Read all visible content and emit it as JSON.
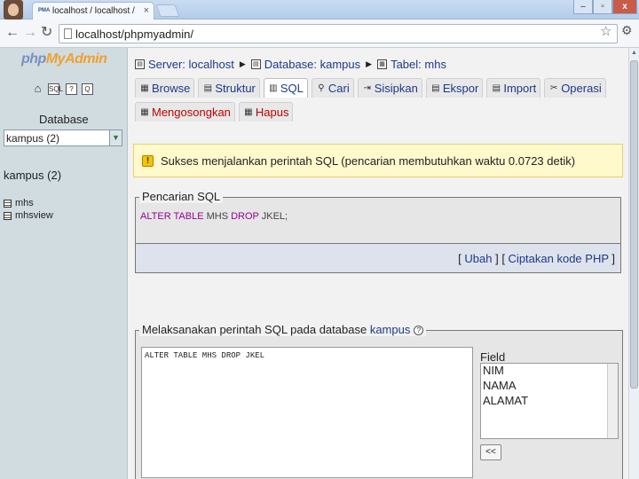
{
  "browser": {
    "tab_title": "localhost / localhost / kampus",
    "tab_favicon": "PMA",
    "url": "localhost/phpmyadmin/",
    "win_min": "–",
    "win_max": "▫",
    "win_close": "x"
  },
  "nav": {
    "logo_php": "php",
    "logo_my": "My",
    "logo_admin": "Admin",
    "database_label": "Database",
    "db_select_value": "kampus (2)",
    "db_name": "kampus (2)",
    "tables": [
      "mhs",
      "mhsview"
    ]
  },
  "breadcrumb": {
    "server": "Server: localhost",
    "database": "Database: kampus",
    "table": "Tabel: mhs"
  },
  "tabs_row1": [
    {
      "label": "Browse",
      "icon": "browse-icon",
      "glyph": "▦"
    },
    {
      "label": "Struktur",
      "icon": "structure-icon",
      "glyph": "▤"
    },
    {
      "label": "SQL",
      "icon": "sql-icon",
      "glyph": "▥"
    },
    {
      "label": "Cari",
      "icon": "search-icon",
      "glyph": "⚲"
    },
    {
      "label": "Sisipkan",
      "icon": "insert-icon",
      "glyph": "⇥"
    },
    {
      "label": "Ekspor",
      "icon": "export-icon",
      "glyph": "▤"
    },
    {
      "label": "Import",
      "icon": "import-icon",
      "glyph": "▤"
    },
    {
      "label": "Operasi",
      "icon": "operations-icon",
      "glyph": "✂"
    }
  ],
  "tabs_row2": [
    {
      "label": "Mengosongkan",
      "icon": "empty-icon",
      "glyph": "▦"
    },
    {
      "label": "Hapus",
      "icon": "drop-icon",
      "glyph": "▦"
    }
  ],
  "message": {
    "success": "Sukses menjalankan perintah SQL (pencarian membutuhkan waktu 0.0723 detik)"
  },
  "sql_box": {
    "legend": "Pencarian SQL",
    "kw1": "ALTER TABLE",
    "table": " MHS ",
    "kw2": "DROP",
    "col": " JKEL;",
    "link_edit": "Ubah",
    "link_php": "Ciptakan kode PHP"
  },
  "run_box": {
    "legend_prefix": "Melaksanakan perintah SQL pada database ",
    "legend_db": "kampus",
    "query": "ALTER TABLE MHS DROP JKEL",
    "field_label": "Field",
    "fields": [
      "NIM",
      "NAMA",
      "ALAMAT"
    ],
    "insert_button": "<<"
  },
  "colors": {
    "accent_link": "#1b3a8a",
    "danger": "#c00000",
    "sql_keyword": "#990099",
    "success_bg": "#fff9cc"
  }
}
